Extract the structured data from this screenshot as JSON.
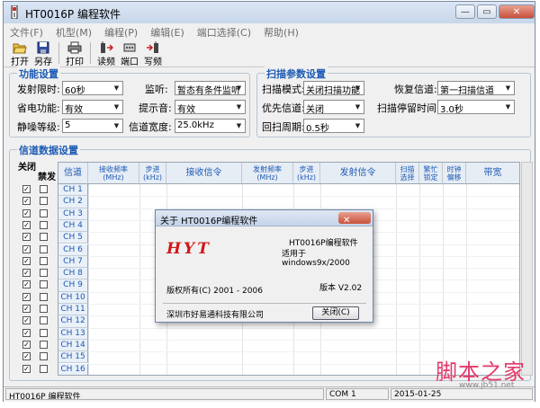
{
  "window": {
    "title": "HT0016P 编程软件"
  },
  "menu": [
    "文件(F)",
    "机型(M)",
    "编程(P)",
    "编辑(E)",
    "端口选择(C)",
    "帮助(H)"
  ],
  "toolbar": {
    "open": "打开",
    "saveas": "另存",
    "print": "打印",
    "read": "读频",
    "port": "端口",
    "write": "写频"
  },
  "function_settings": {
    "title": "功能设置",
    "launch_limit_label": "发射限时:",
    "launch_limit_value": "60秒",
    "monitor_label": "监听:",
    "monitor_value": "暂态有条件监听",
    "power_save_label": "省电功能:",
    "power_save_value": "有效",
    "beep_label": "提示音:",
    "beep_value": "有效",
    "squelch_label": "静噪等级:",
    "squelch_value": "5",
    "bandwidth_label": "信道宽度:",
    "bandwidth_value": "25.0kHz"
  },
  "scan_settings": {
    "title": "扫描参数设置",
    "mode_label": "扫描模式:",
    "mode_value": "关闭扫描功能",
    "resume_label": "恢复信道:",
    "resume_value": "第一扫描信道",
    "priority_label": "优先信道:",
    "priority_value": "关闭",
    "dwell_label": "扫描停留时间:",
    "dwell_value": "3.0秒",
    "period_label": "回扫周期:",
    "period_value": "0.5秒"
  },
  "channel_settings": {
    "title": "信道数据设置",
    "close_label": "关闭",
    "busy_label": "禁发",
    "columns": [
      "信道",
      "接收频率\n(MHz)",
      "步进\n(kHz)",
      "接收信令",
      "发射频率\n(MHz)",
      "步进\n(kHz)",
      "发射信令",
      "扫描\n选择",
      "繁忙\n锁定",
      "时钟\n偏移",
      "带宽"
    ],
    "channels": [
      "CH 1",
      "CH 2",
      "CH 3",
      "CH 4",
      "CH 5",
      "CH 6",
      "CH 7",
      "CH 8",
      "CH 9",
      "CH 10",
      "CH 11",
      "CH 12",
      "CH 13",
      "CH 14",
      "CH 15",
      "CH 16"
    ],
    "check_mark": "✓"
  },
  "status": {
    "app": "HT0016P 编程软件",
    "port": "COM 1",
    "date": "2015-01-25"
  },
  "about_dialog": {
    "title": "关于 HT0016P编程软件",
    "close_label": "✕",
    "logo": "HYT",
    "product": "HT0016P编程软件",
    "compat": "适用于windows9x/2000",
    "copyright": "版权所有(C) 2001 - 2006",
    "version": "版本  V2.02",
    "company": "深圳市好易通科技有限公司",
    "button": "关闭(C)"
  },
  "watermark": {
    "text": "脚本之家",
    "url": "www.jb51.net"
  },
  "colors": {
    "accent": "#1c5ab4",
    "logo": "#d01818",
    "watermark": "#e23a6a"
  }
}
